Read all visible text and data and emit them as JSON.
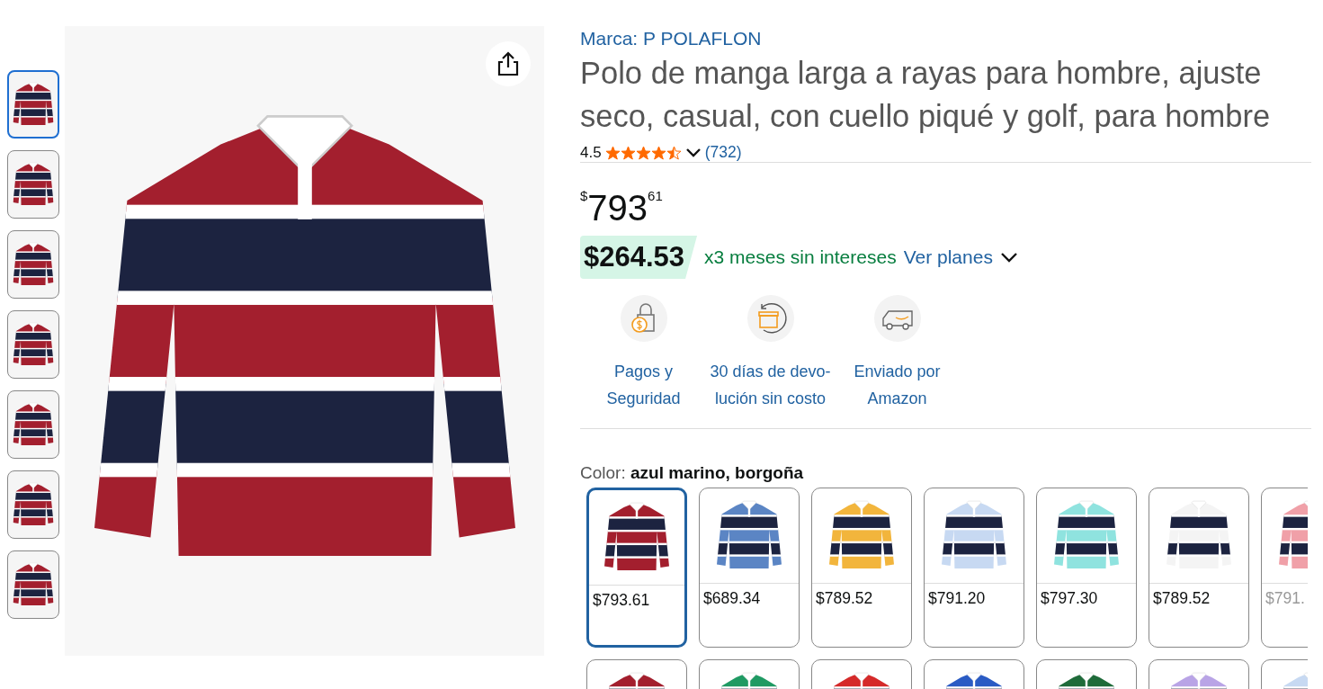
{
  "thumbnails": [
    {
      "selected": true
    },
    {
      "selected": false
    },
    {
      "selected": false
    },
    {
      "selected": false
    },
    {
      "selected": false
    },
    {
      "selected": false
    },
    {
      "selected": false
    }
  ],
  "brand": "Marca: P POLAFLON",
  "title": "Polo de manga larga a rayas para hombre, ajuste seco, casual, con cuello piqué y golf, para hombre",
  "rating": {
    "value": "4.5",
    "stars": 4.5,
    "count": "(732)"
  },
  "price": {
    "symbol": "$",
    "whole": "793",
    "fraction": "61"
  },
  "installment": {
    "amount": "$264.53",
    "terms": "x3 meses sin intereses",
    "link": "Ver planes"
  },
  "features": [
    {
      "kind": "payment",
      "lines": [
        "Pagos y",
        "Seguridad"
      ]
    },
    {
      "kind": "return",
      "lines": [
        "30 días de devo-",
        "lución sin costo"
      ]
    },
    {
      "kind": "delivery",
      "lines": [
        "Enviado por",
        "Amazon"
      ]
    }
  ],
  "color": {
    "label": "Color:",
    "value": "azul marino, borgoña"
  },
  "swatches": [
    {
      "selected": true,
      "price": "$793.61",
      "color": "#a31f2e"
    },
    {
      "selected": false,
      "price": "$689.34",
      "color": "#5b85c4"
    },
    {
      "selected": false,
      "price": "$789.52",
      "color": "#f2b53c"
    },
    {
      "selected": false,
      "price": "$791.20",
      "color": "#c7d9f2"
    },
    {
      "selected": false,
      "price": "$797.30",
      "color": "#8fe3df"
    },
    {
      "selected": false,
      "price": "$789.52",
      "color": "#f4f4f4"
    },
    {
      "selected": false,
      "price": "$791.",
      "color": "#f0a0a8"
    },
    {
      "selected": false,
      "color": "#a31f2e"
    },
    {
      "selected": false,
      "color": "#1f9a63"
    },
    {
      "selected": false,
      "color": "#d52a2a"
    },
    {
      "selected": false,
      "color": "#2a5bc4"
    },
    {
      "selected": false,
      "color": "#1f6b3a"
    },
    {
      "selected": false,
      "color": "#b9a4e6"
    },
    {
      "selected": false,
      "color": "#c7d9f2"
    }
  ]
}
